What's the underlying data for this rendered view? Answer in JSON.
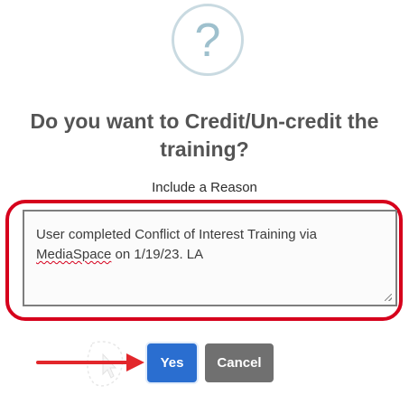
{
  "dialog": {
    "icon": "question-mark-icon",
    "icon_glyph": "?",
    "title_line1": "Do you want to Credit/Un-credit the",
    "title_line2": "training?",
    "reason_label": "Include a Reason",
    "reason_text_part1": "User completed Conflict of Interest Training via",
    "reason_text_misspelled": "MediaSpace",
    "reason_text_part2": " on 1/19/23. LA",
    "yes_label": "Yes",
    "cancel_label": "Cancel"
  },
  "colors": {
    "icon_ring": "#c9dae1",
    "icon_glyph": "#9ec0cd",
    "highlight": "#d6001c",
    "yes_button": "#2a6ed0",
    "cancel_button": "#707070",
    "arrow": "#e2262b"
  },
  "annotations": {
    "highlight_box": "red-rounded-outline",
    "pointer": "red-arrow-icon"
  }
}
